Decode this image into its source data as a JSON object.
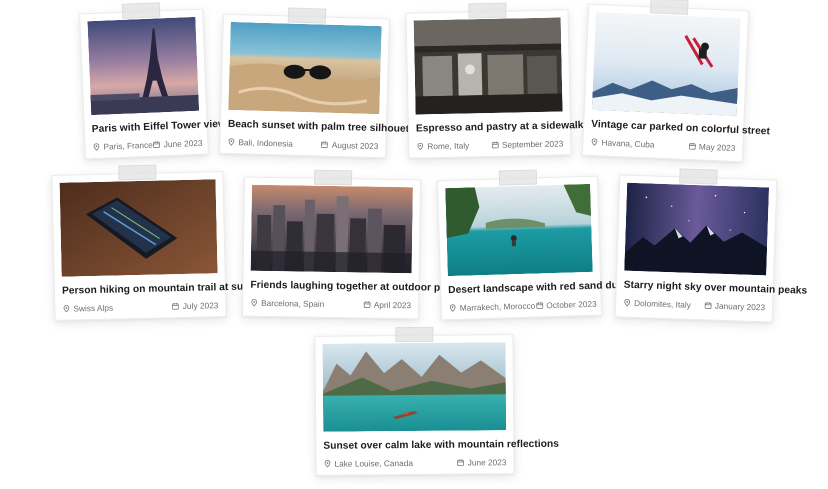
{
  "cards": [
    {
      "title": "Paris with Eiffel Tower view",
      "location": "Paris, France",
      "date": "June 2023",
      "image": "eiffel-tower-dusk"
    },
    {
      "title": "Beach sunset with palm tree silhouettes",
      "location": "Bali, Indonesia",
      "date": "August 2023",
      "image": "sunglasses-on-sand"
    },
    {
      "title": "Espresso and pastry at a sidewalk cafe",
      "location": "Rome, Italy",
      "date": "September 2023",
      "image": "espresso-machine"
    },
    {
      "title": "Vintage car parked on colorful street",
      "location": "Havana, Cuba",
      "date": "May 2023",
      "image": "skier-jump"
    },
    {
      "title": "Person hiking on mountain trail at sunrise",
      "location": "Swiss Alps",
      "date": "July 2023",
      "image": "smartphone-on-table"
    },
    {
      "title": "Friends laughing together at outdoor party",
      "location": "Barcelona, Spain",
      "date": "April 2023",
      "image": "city-skyline"
    },
    {
      "title": "Desert landscape with red sand dunes",
      "location": "Marrakech, Morocco",
      "date": "October 2023",
      "image": "infinity-pool"
    },
    {
      "title": "Starry night sky over mountain peaks",
      "location": "Dolomites, Italy",
      "date": "January 2023",
      "image": "milky-way-mountains"
    },
    {
      "title": "Sunset over calm lake with mountain reflections",
      "location": "Lake Louise, Canada",
      "date": "June 2023",
      "image": "mountain-lake-boat"
    }
  ],
  "icons": {
    "location": "map-pin-icon",
    "date": "calendar-icon"
  }
}
